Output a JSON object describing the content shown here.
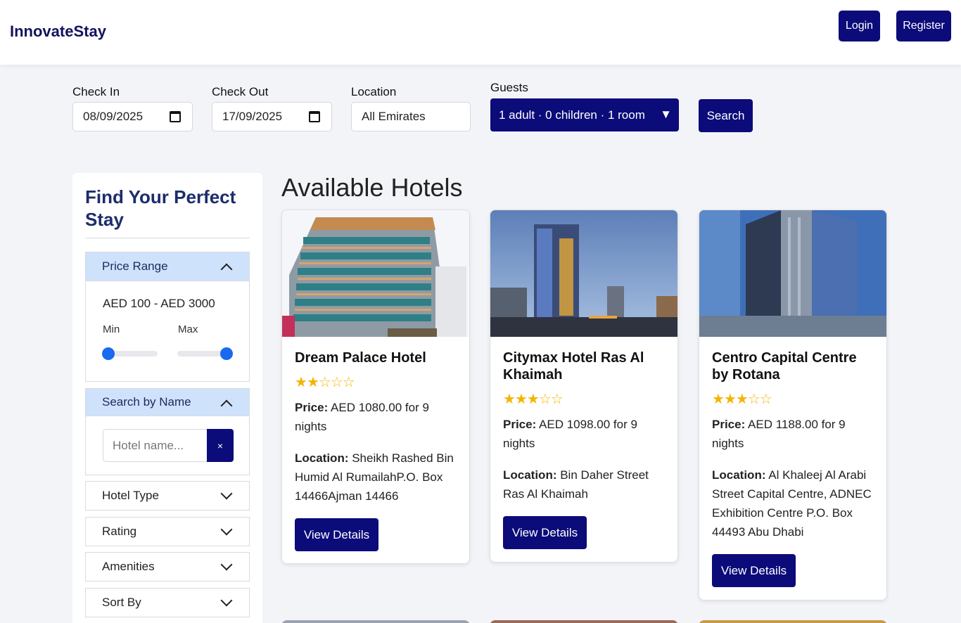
{
  "app": {
    "brand": "InnovateStay",
    "login_label": "Login",
    "register_label": "Register"
  },
  "search": {
    "check_in_label": "Check In",
    "check_in_value": "08/09/2025",
    "check_out_label": "Check Out",
    "check_out_value": "17/09/2025",
    "location_label": "Location",
    "location_value": "All Emirates",
    "guests_label": "Guests",
    "guests_value": "1 adult · 0 children · 1 room",
    "search_label": "Search"
  },
  "sidebar": {
    "title": "Find Your Perfect Stay",
    "price": {
      "header": "Price Range",
      "range_text": "AED 100 - AED 3000",
      "min_label": "Min",
      "max_label": "Max"
    },
    "name_search": {
      "header": "Search by Name",
      "placeholder": "Hotel name...",
      "clear": "×"
    },
    "sections": [
      "Hotel Type",
      "Rating",
      "Amenities",
      "Sort By"
    ]
  },
  "main": {
    "title": "Available Hotels"
  },
  "labels": {
    "price": "Price:",
    "location": "Location:",
    "view_details": "View Details"
  },
  "hotels": [
    {
      "name": "Dream Palace Hotel",
      "stars": 2,
      "price": " AED 1080.00 for 9 nights",
      "location": " Sheikh Rashed Bin Humid Al RumailahP.O. Box 14466Ajman 14466"
    },
    {
      "name": "Citymax Hotel Ras Al Khaimah",
      "stars": 3,
      "price": " AED 1098.00 for 9 nights",
      "location": " Bin Daher Street Ras Al Khaimah"
    },
    {
      "name": "Centro Capital Centre by Rotana",
      "stars": 3,
      "price": " AED 1188.00 for 9 nights",
      "location": " Al Khaleej Al Arabi Street Capital Centre, ADNEC Exhibition Centre P.O. Box 44493 Abu Dhabi"
    }
  ]
}
